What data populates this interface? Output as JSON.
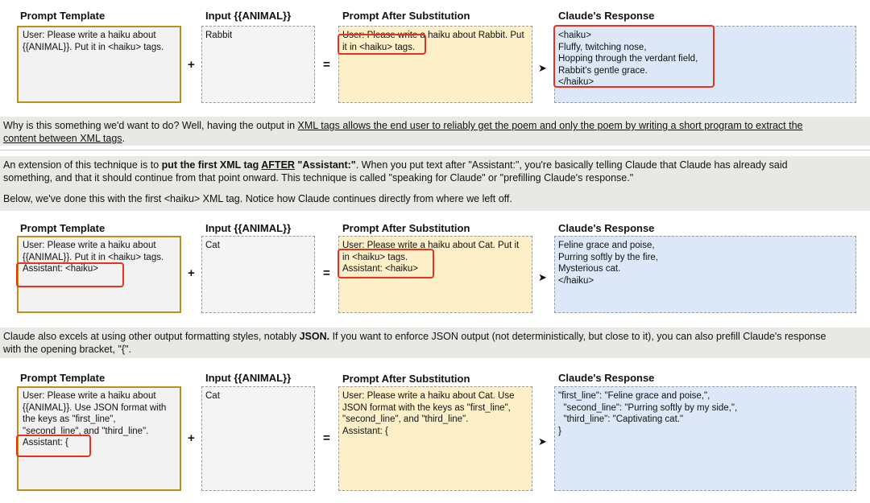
{
  "headers": {
    "template": "Prompt Template",
    "input": "Input {{ANIMAL}}",
    "substitution": "Prompt After Substitution",
    "response": "Claude's Response"
  },
  "operators": {
    "plus": "+",
    "equals": "=",
    "arrow": "➤"
  },
  "rows": [
    {
      "template": "User: Please write a haiku about\n{{ANIMAL}}. Put it in <haiku> tags.",
      "input": "Rabbit",
      "substitution": "User: Please write a haiku about Rabbit. Put\nit in <haiku> tags.",
      "response": "<haiku>\nFluffy, twitching nose,\nHopping through the verdant field,\nRabbit's gentle grace.\n</haiku>"
    },
    {
      "template": "User: Please write a haiku about\n{{ANIMAL}}. Put it in <haiku> tags.\nAssistant: <haiku>",
      "input": "Cat",
      "substitution": "User: Please write a haiku about Cat. Put it\nin <haiku> tags.\nAssistant: <haiku>",
      "response": "Feline grace and poise,\nPurring softly by the fire,\nMysterious cat.\n</haiku>"
    },
    {
      "template": "User: Please write a haiku about\n{{ANIMAL}}. Use JSON format with\nthe keys as \"first_line\",\n\"second_line\", and \"third_line\".\nAssistant: {",
      "input": "Cat",
      "substitution": "User: Please write a haiku about Cat. Use\nJSON format with the keys as \"first_line\",\n\"second_line\", and \"third_line\".\nAssistant: {",
      "response": "\"first_line\": \"Feline grace and poise,\",\n  \"second_line\": \"Purring softly by my side,\",\n  \"third_line\": \"Captivating cat.\"\n}"
    }
  ],
  "paragraphs": {
    "p1_line1_a": "Why is this something we'd want to do? Well, having the output in ",
    "p1_line1_u": "XML tags allows the end user to reliably get the poem and only the poem by writing a short program to extract the",
    "p1_line2_u": "content between XML tags",
    "p1_line2_b": ".",
    "p2_line1_a": "An extension of this technique is to ",
    "p2_line1_b1": "put the first XML tag ",
    "p2_line1_bu": "AFTER",
    "p2_line1_b2": " \"Assistant:\"",
    "p2_line1_c": ". When you put text after \"Assistant:\", you're basically telling Claude that Claude has already said",
    "p2_line2": "something, and that it should continue from that point onward. This technique is called \"speaking for Claude\" or \"prefilling Claude's response.\"",
    "p3": "Below, we've done this with the first <haiku> XML tag. Notice how Claude continues directly from where we left off.",
    "p4_line1_a": "Claude also excels at using other output formatting styles, notably ",
    "p4_line1_b": "JSON.",
    "p4_line1_c": " If you want to enforce JSON output (not deterministically, but close to it), you can also prefill Claude's response",
    "p4_line2": "with the opening bracket, \"{\"."
  },
  "colors": {
    "template_border": "#b8901a",
    "highlight": "#e8311e",
    "substitution_bg": "#fdf0c8",
    "response_bg": "#dce8f7",
    "band_bg": "#e8e8e5"
  }
}
